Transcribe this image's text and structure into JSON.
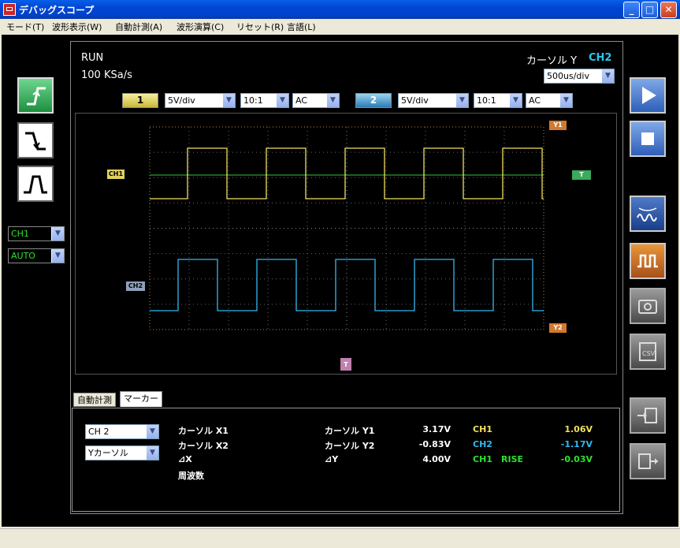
{
  "window": {
    "title": "デバッグスコープ"
  },
  "menu": [
    "モード(T)",
    "波形表示(W)",
    "自動計測(A)",
    "波形演算(C)",
    "リセット(R)",
    "言語(L)"
  ],
  "status": {
    "run": "RUN",
    "sample_rate": "100 KSa/s"
  },
  "cursor_mode": {
    "label": "カーソル Y",
    "channel": "CH2",
    "channel_color": "#27C8F0"
  },
  "timebase": "500us/div",
  "ch1": {
    "button": "1",
    "volt_div": "5V/div",
    "probe": "10:1",
    "coupling": "AC",
    "color": "#F0E060"
  },
  "ch2": {
    "button": "2",
    "volt_div": "5V/div",
    "probe": "10:1",
    "coupling": "AC",
    "color": "#30B8F0"
  },
  "left_panel": {
    "trigger_source": "CH1",
    "trigger_mode": "AUTO"
  },
  "markers": {
    "ch1": "CH1",
    "ch2": "CH2",
    "y1": "Y1",
    "y2": "Y2",
    "trig_level": "T",
    "trig_pos": "T"
  },
  "tabs": [
    "自動計測",
    "マーカー"
  ],
  "marker_panel": {
    "channel_select": "CH 2",
    "cursor_select": "Yカーソル",
    "labels": [
      "カーソル X1",
      "カーソル X2",
      "⊿X",
      "周波数"
    ],
    "y_labels": [
      "カーソル Y1",
      "カーソル Y2",
      "⊿Y"
    ],
    "y_values": [
      "3.17V",
      "-0.83V",
      "4.00V"
    ],
    "ch_rows": [
      {
        "name": "CH1",
        "extra": "",
        "value": "1.06V",
        "color": "#F0E060"
      },
      {
        "name": "CH2",
        "extra": "",
        "value": "-1.17V",
        "color": "#30B8F0"
      },
      {
        "name": "CH1",
        "extra": "RISE",
        "value": "-0.03V",
        "color": "#2DE22D"
      }
    ]
  },
  "colors": {
    "grid": "#C08040",
    "trigger_line": "#34C634"
  }
}
